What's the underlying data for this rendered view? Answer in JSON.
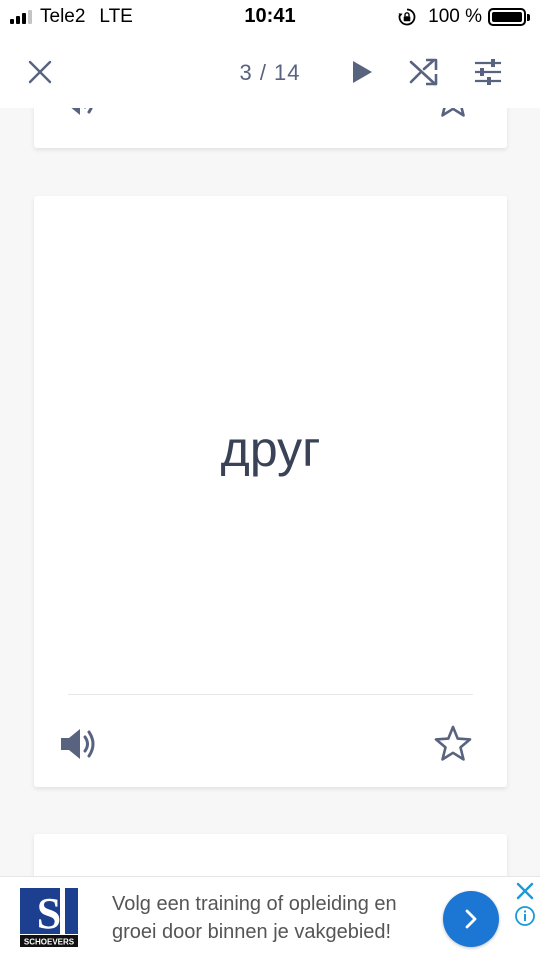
{
  "status_bar": {
    "carrier": "Tele2",
    "network": "LTE",
    "time": "10:41",
    "battery": "100 %",
    "battery_level": 1.0
  },
  "toolbar": {
    "counter": "3 / 14",
    "icons": {
      "close": "close-icon",
      "play": "play-icon",
      "shuffle": "shuffle-icon",
      "settings": "settings-sliders-icon"
    }
  },
  "card": {
    "term": "друг",
    "icons": {
      "audio": "speaker-icon",
      "star": "star-icon"
    }
  },
  "ad": {
    "brand": "SCHOEVERS",
    "logo_letter": "S",
    "text": "Volg een training of opleiding en groei door binnen je vakgebied!",
    "accent_color": "#1b77d3"
  },
  "colors": {
    "icon": "#586380",
    "text": "#3a4257",
    "background": "#f7f7f7"
  }
}
